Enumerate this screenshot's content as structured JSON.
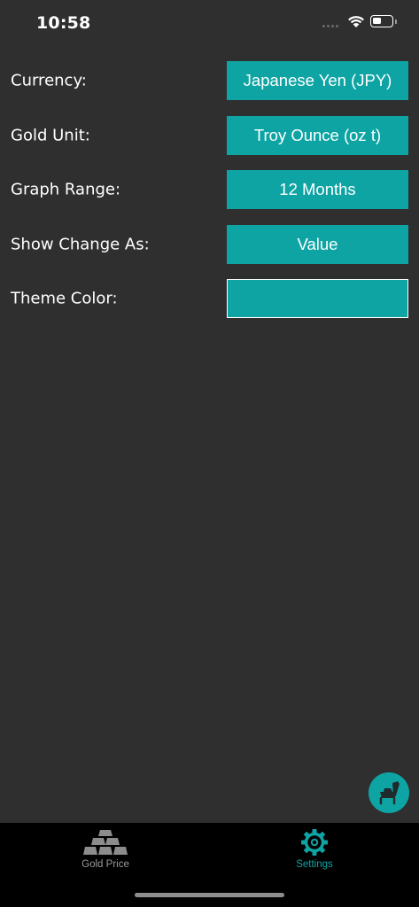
{
  "status_bar": {
    "time": "10:58"
  },
  "settings": [
    {
      "label": "Currency:",
      "value": "Japanese Yen (JPY)"
    },
    {
      "label": "Gold Unit:",
      "value": "Troy Ounce (oz t)"
    },
    {
      "label": "Graph Range:",
      "value": "12 Months"
    },
    {
      "label": "Show Change As:",
      "value": "Value"
    },
    {
      "label": "Theme Color:",
      "value": ""
    }
  ],
  "theme_color": "#0fa4a4",
  "tabs": [
    {
      "label": "Gold Price",
      "icon": "gold-bars-icon",
      "active": false
    },
    {
      "label": "Settings",
      "icon": "gear-icon",
      "active": true
    }
  ],
  "fab": {
    "icon": "chair-icon"
  },
  "colors": {
    "background": "#2f2f2f",
    "accent": "#0fa4a4",
    "tab_bar": "#000000",
    "inactive_tab": "#9a9a9a"
  }
}
